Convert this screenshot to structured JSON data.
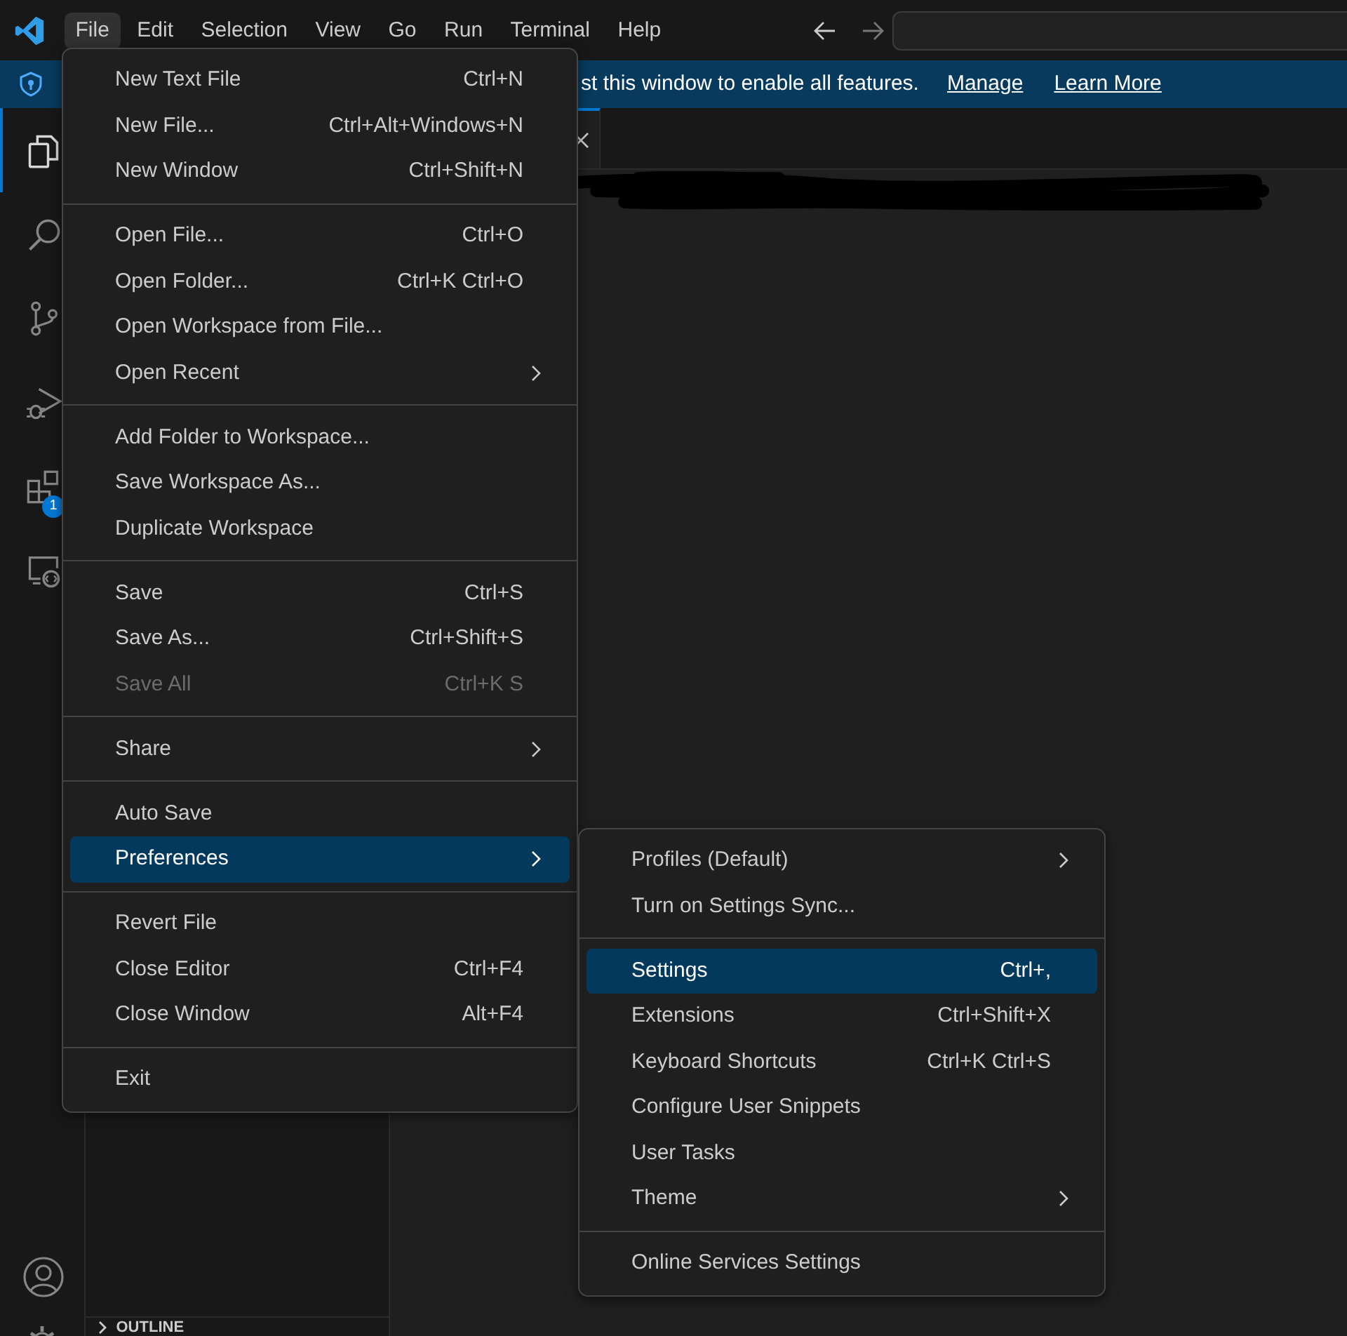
{
  "title_bar": {
    "menus": [
      {
        "label": "File",
        "selected": true
      },
      {
        "label": "Edit",
        "selected": false
      },
      {
        "label": "Selection",
        "selected": false
      },
      {
        "label": "View",
        "selected": false
      },
      {
        "label": "Go",
        "selected": false
      },
      {
        "label": "Run",
        "selected": false
      },
      {
        "label": "Terminal",
        "selected": false
      },
      {
        "label": "Help",
        "selected": false
      }
    ]
  },
  "banner": {
    "text": "st this window to enable all features.",
    "links": [
      "Manage",
      "Learn More"
    ]
  },
  "activity_bar": {
    "items": [
      {
        "kind": "explorer",
        "selected": true
      },
      {
        "kind": "search",
        "selected": false
      },
      {
        "kind": "source-control",
        "selected": false
      },
      {
        "kind": "run-debug",
        "selected": false
      },
      {
        "kind": "extensions",
        "selected": false,
        "badge": "1"
      },
      {
        "kind": "remote",
        "selected": false
      }
    ]
  },
  "sidebar": {
    "sections": [
      {
        "label": "OUTLINE",
        "expanded": false
      }
    ]
  },
  "file_menu": {
    "groups": [
      [
        {
          "label": "New Text File",
          "shortcut": "Ctrl+N",
          "disabled": false,
          "submenu": false,
          "selected": false
        },
        {
          "label": "New File...",
          "shortcut": "Ctrl+Alt+Windows+N",
          "disabled": false,
          "submenu": false,
          "selected": false
        },
        {
          "label": "New Window",
          "shortcut": "Ctrl+Shift+N",
          "disabled": false,
          "submenu": false,
          "selected": false
        }
      ],
      [
        {
          "label": "Open File...",
          "shortcut": "Ctrl+O",
          "disabled": false,
          "submenu": false,
          "selected": false
        },
        {
          "label": "Open Folder...",
          "shortcut": "Ctrl+K Ctrl+O",
          "disabled": false,
          "submenu": false,
          "selected": false
        },
        {
          "label": "Open Workspace from File...",
          "disabled": false,
          "submenu": false,
          "selected": false
        },
        {
          "label": "Open Recent",
          "disabled": false,
          "submenu": true,
          "selected": false
        }
      ],
      [
        {
          "label": "Add Folder to Workspace...",
          "disabled": false,
          "submenu": false,
          "selected": false
        },
        {
          "label": "Save Workspace As...",
          "disabled": false,
          "submenu": false,
          "selected": false
        },
        {
          "label": "Duplicate Workspace",
          "disabled": false,
          "submenu": false,
          "selected": false
        }
      ],
      [
        {
          "label": "Save",
          "shortcut": "Ctrl+S",
          "disabled": false,
          "submenu": false,
          "selected": false
        },
        {
          "label": "Save As...",
          "shortcut": "Ctrl+Shift+S",
          "disabled": false,
          "submenu": false,
          "selected": false
        },
        {
          "label": "Save All",
          "shortcut": "Ctrl+K S",
          "disabled": true,
          "submenu": false,
          "selected": false
        }
      ],
      [
        {
          "label": "Share",
          "disabled": false,
          "submenu": true,
          "selected": false
        }
      ],
      [
        {
          "label": "Auto Save",
          "disabled": false,
          "submenu": false,
          "selected": false
        },
        {
          "label": "Preferences",
          "disabled": false,
          "submenu": true,
          "selected": true
        }
      ],
      [
        {
          "label": "Revert File",
          "disabled": false,
          "submenu": false,
          "selected": false
        },
        {
          "label": "Close Editor",
          "shortcut": "Ctrl+F4",
          "disabled": false,
          "submenu": false,
          "selected": false
        },
        {
          "label": "Close Window",
          "shortcut": "Alt+F4",
          "disabled": false,
          "submenu": false,
          "selected": false
        }
      ],
      [
        {
          "label": "Exit",
          "disabled": false,
          "submenu": false,
          "selected": false
        }
      ]
    ]
  },
  "preferences_submenu": {
    "groups": [
      [
        {
          "label": "Profiles (Default)",
          "disabled": false,
          "submenu": true,
          "selected": false
        },
        {
          "label": "Turn on Settings Sync...",
          "disabled": false,
          "submenu": false,
          "selected": false
        }
      ],
      [
        {
          "label": "Settings",
          "shortcut": "Ctrl+,",
          "disabled": false,
          "submenu": false,
          "selected": true
        },
        {
          "label": "Extensions",
          "shortcut": "Ctrl+Shift+X",
          "disabled": false,
          "submenu": false,
          "selected": false
        },
        {
          "label": "Keyboard Shortcuts",
          "shortcut": "Ctrl+K Ctrl+S",
          "disabled": false,
          "submenu": false,
          "selected": false
        },
        {
          "label": "Configure User Snippets",
          "disabled": false,
          "submenu": false,
          "selected": false
        },
        {
          "label": "User Tasks",
          "disabled": false,
          "submenu": false,
          "selected": false
        },
        {
          "label": "Theme",
          "disabled": false,
          "submenu": true,
          "selected": false
        }
      ],
      [
        {
          "label": "Online Services Settings",
          "disabled": false,
          "submenu": false,
          "selected": false
        }
      ]
    ]
  }
}
